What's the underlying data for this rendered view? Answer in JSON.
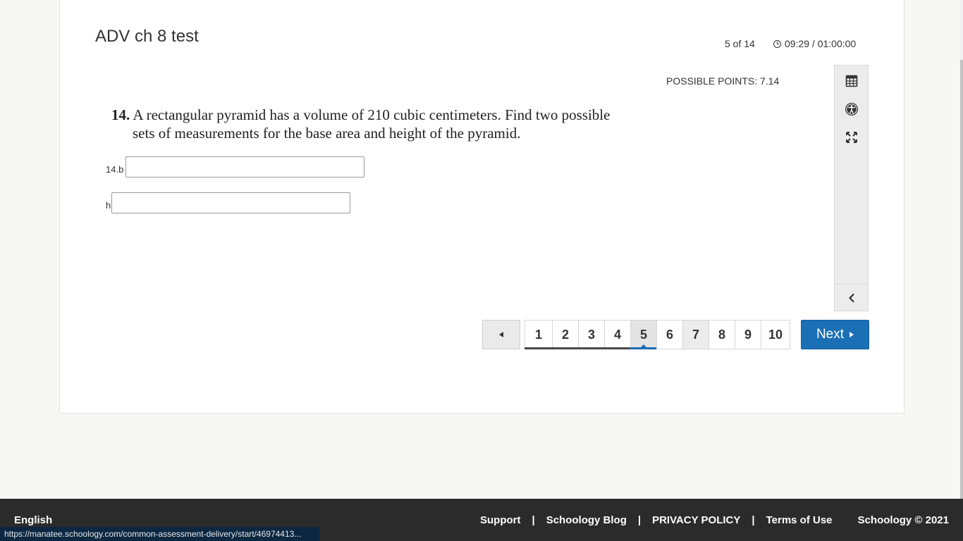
{
  "test": {
    "title": "ADV ch 8 test",
    "progress": "5 of 14",
    "timer": "09:29 / 01:00:00",
    "possible_points": "POSSIBLE POINTS: 7.14"
  },
  "question": {
    "number": "14.",
    "text_line1": "A rectangular pyramid has a volume of 210 cubic centimeters. Find two possible",
    "text_line2": "sets of measurements for the base area and height of the pyramid.",
    "fields": [
      {
        "label": "14.b",
        "value": ""
      },
      {
        "label": "h",
        "value": ""
      }
    ]
  },
  "toolbar": {
    "icons": [
      "calculator-icon",
      "accessibility-icon",
      "fullscreen-icon",
      "collapse-chevron-icon"
    ]
  },
  "pagination": {
    "pages": [
      "1",
      "2",
      "3",
      "4",
      "5",
      "6",
      "7",
      "8",
      "9",
      "10"
    ],
    "current": "5",
    "next_label": "Next"
  },
  "footer": {
    "language": "English",
    "links": [
      "Support",
      "Schoology Blog",
      "PRIVACY POLICY",
      "Terms of Use"
    ],
    "separator": "|",
    "copyright": "Schoology © 2021"
  },
  "status_url": "https://manatee.schoology.com/common-assessment-delivery/start/46974413...",
  "colors": {
    "accent": "#1a6fb5",
    "footer_bg": "#2b2b2b",
    "page_bg": "#f7f7f6"
  }
}
